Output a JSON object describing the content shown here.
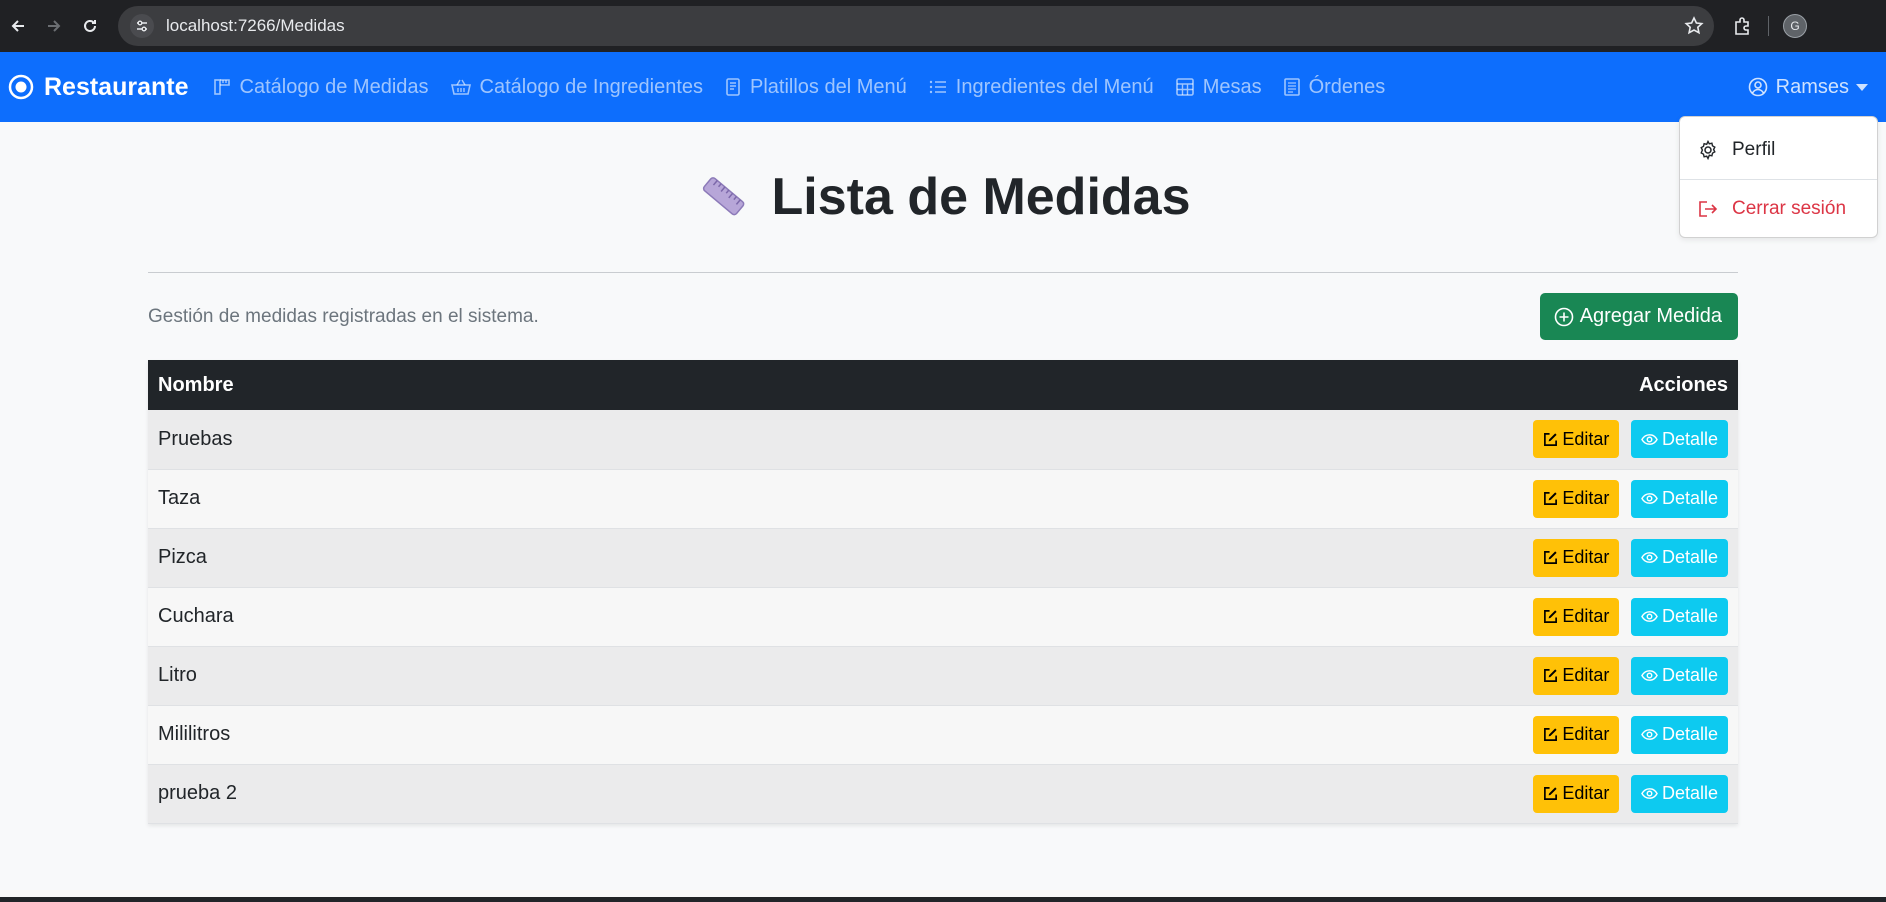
{
  "browser": {
    "url": "localhost:7266/Medidas",
    "profile_initial": "G"
  },
  "navbar": {
    "brand": "Restaurante",
    "items": [
      {
        "label": "Catálogo de Medidas",
        "icon": "ruler-icon"
      },
      {
        "label": "Catálogo de Ingredientes",
        "icon": "basket-icon"
      },
      {
        "label": "Platillos del Menú",
        "icon": "journal-icon"
      },
      {
        "label": "Ingredientes del Menú",
        "icon": "list-icon"
      },
      {
        "label": "Mesas",
        "icon": "table-icon"
      },
      {
        "label": "Órdenes",
        "icon": "receipt-icon"
      }
    ],
    "user": "Ramses"
  },
  "dropdown": {
    "profile_label": "Perfil",
    "logout_label": "Cerrar sesión"
  },
  "page": {
    "title": "Lista de Medidas",
    "subtitle": "Gestión de medidas registradas en el sistema.",
    "add_button": "Agregar Medida"
  },
  "table": {
    "headers": {
      "name": "Nombre",
      "actions": "Acciones"
    },
    "edit_label": "Editar",
    "detail_label": "Detalle",
    "rows": [
      {
        "name": "Pruebas"
      },
      {
        "name": "Taza"
      },
      {
        "name": "Pizca"
      },
      {
        "name": "Cuchara"
      },
      {
        "name": "Litro"
      },
      {
        "name": "Mililitros"
      },
      {
        "name": "prueba 2"
      }
    ]
  },
  "colors": {
    "primary": "#0d6efd",
    "success": "#198754",
    "warning": "#ffc107",
    "info": "#0dcaf0",
    "danger": "#dc3545",
    "dark": "#212529"
  }
}
